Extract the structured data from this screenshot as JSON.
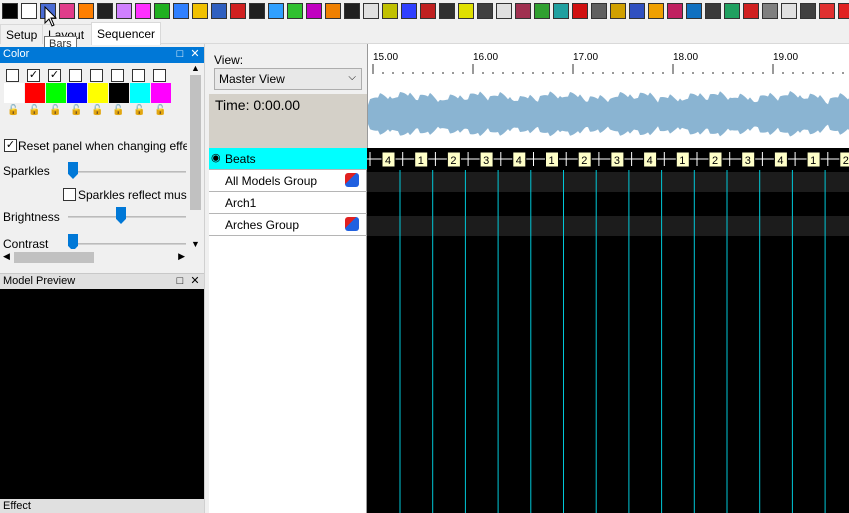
{
  "toolbar": {
    "effect_icons": [
      {
        "name": "off",
        "color": "#000000"
      },
      {
        "name": "on",
        "color": "#ffffff"
      },
      {
        "name": "bars",
        "color": "#4a6cd4"
      },
      {
        "name": "butterfly",
        "color": "#e03c8a"
      },
      {
        "name": "candle",
        "color": "#ff7f00"
      },
      {
        "name": "circles",
        "color": "#222222"
      },
      {
        "name": "color-wash",
        "color": "#d080ff"
      },
      {
        "name": "curtain",
        "color": "#ff30ff"
      },
      {
        "name": "dmx",
        "color": "#20b020"
      },
      {
        "name": "faces",
        "color": "#3080ff"
      },
      {
        "name": "fan",
        "color": "#f0c000"
      },
      {
        "name": "fill",
        "color": "#3060c0"
      },
      {
        "name": "fire",
        "color": "#d02020"
      },
      {
        "name": "fireworks",
        "color": "#202020"
      },
      {
        "name": "galaxy",
        "color": "#30a0ff"
      },
      {
        "name": "garlands",
        "color": "#30c030"
      },
      {
        "name": "glediator",
        "color": "#c000c0"
      },
      {
        "name": "kaleidoscope",
        "color": "#f08000"
      },
      {
        "name": "life",
        "color": "#202020"
      },
      {
        "name": "lightning",
        "color": "#e0e0e0"
      },
      {
        "name": "lines",
        "color": "#c0c000"
      },
      {
        "name": "liquid",
        "color": "#3040ff"
      },
      {
        "name": "marquee",
        "color": "#c02020"
      },
      {
        "name": "meteors",
        "color": "#303030"
      },
      {
        "name": "morph",
        "color": "#e0e000"
      },
      {
        "name": "music",
        "color": "#404040"
      },
      {
        "name": "piano",
        "color": "#e0e0e0"
      },
      {
        "name": "pictures",
        "color": "#a03050"
      },
      {
        "name": "pinwheel",
        "color": "#30a030"
      },
      {
        "name": "plasma",
        "color": "#20a0a0"
      },
      {
        "name": "ripple",
        "color": "#d01010"
      },
      {
        "name": "servo",
        "color": "#606060"
      },
      {
        "name": "shader",
        "color": "#d0a000"
      },
      {
        "name": "shape",
        "color": "#3050c0"
      },
      {
        "name": "shimmer",
        "color": "#f0a000"
      },
      {
        "name": "shockwave",
        "color": "#c02060"
      },
      {
        "name": "single-strand",
        "color": "#1070c0"
      },
      {
        "name": "sketch",
        "color": "#3a3a3a"
      },
      {
        "name": "snowflakes",
        "color": "#20a060"
      },
      {
        "name": "snowstorm",
        "color": "#d02020"
      },
      {
        "name": "spirals",
        "color": "#808080"
      },
      {
        "name": "spirograph",
        "color": "#e0e0e0"
      },
      {
        "name": "state",
        "color": "#404040"
      },
      {
        "name": "strobe",
        "color": "#e03030"
      },
      {
        "name": "tendril",
        "color": "#e02020"
      },
      {
        "name": "text",
        "color": "#20a020"
      },
      {
        "name": "tree",
        "color": "#e03030"
      }
    ],
    "tooltip": "Bars"
  },
  "tabs": [
    {
      "label": "Setup"
    },
    {
      "label": "Layout"
    },
    {
      "label": "Sequencer"
    }
  ],
  "color_panel": {
    "title": "Color",
    "checkboxes": [
      "☐",
      "☑",
      "☑",
      "☐",
      "☐",
      "☐",
      "☐",
      "☐"
    ],
    "swatches": [
      "#ffffff",
      "#ff0000",
      "#00ff00",
      "#0000ff",
      "#ffff00",
      "#000000",
      "#00ffff",
      "#ff00ff"
    ],
    "reset_label": "Reset panel when changing effe",
    "sparkles_label": "Sparkles",
    "sparkles_value": 0,
    "sparkles_music_label": "Sparkles reflect musi",
    "brightness_label": "Brightness",
    "brightness_percent": 100,
    "contrast_label": "Contrast",
    "contrast_value": 0
  },
  "model_preview": {
    "title": "Model Preview"
  },
  "effect_panel": {
    "title": "Effect"
  },
  "sequencer": {
    "view_label": "View:",
    "view_selected": "Master View",
    "time_display": "Time: 0:00.00",
    "ruler_labels": [
      "15.00",
      "16.00",
      "17.00",
      "18.00",
      "19.00"
    ],
    "rows": [
      {
        "name": "Beats",
        "type": "timing"
      },
      {
        "name": "All Models Group",
        "type": "group"
      },
      {
        "name": "Arch1",
        "type": "model"
      },
      {
        "name": "Arches Group",
        "type": "group"
      }
    ],
    "beat_labels": [
      "4",
      "1",
      "2",
      "3",
      "4",
      "1",
      "2",
      "3",
      "4",
      "1",
      "2",
      "3",
      "4",
      "1",
      "2"
    ],
    "colors": {
      "timing_row": "#00ffff",
      "beat_line": "#00c8d8",
      "waveform": "#8ab4d2",
      "grid_row_dark": "#1c1c1c",
      "beat_box": "#ffffc8"
    }
  }
}
